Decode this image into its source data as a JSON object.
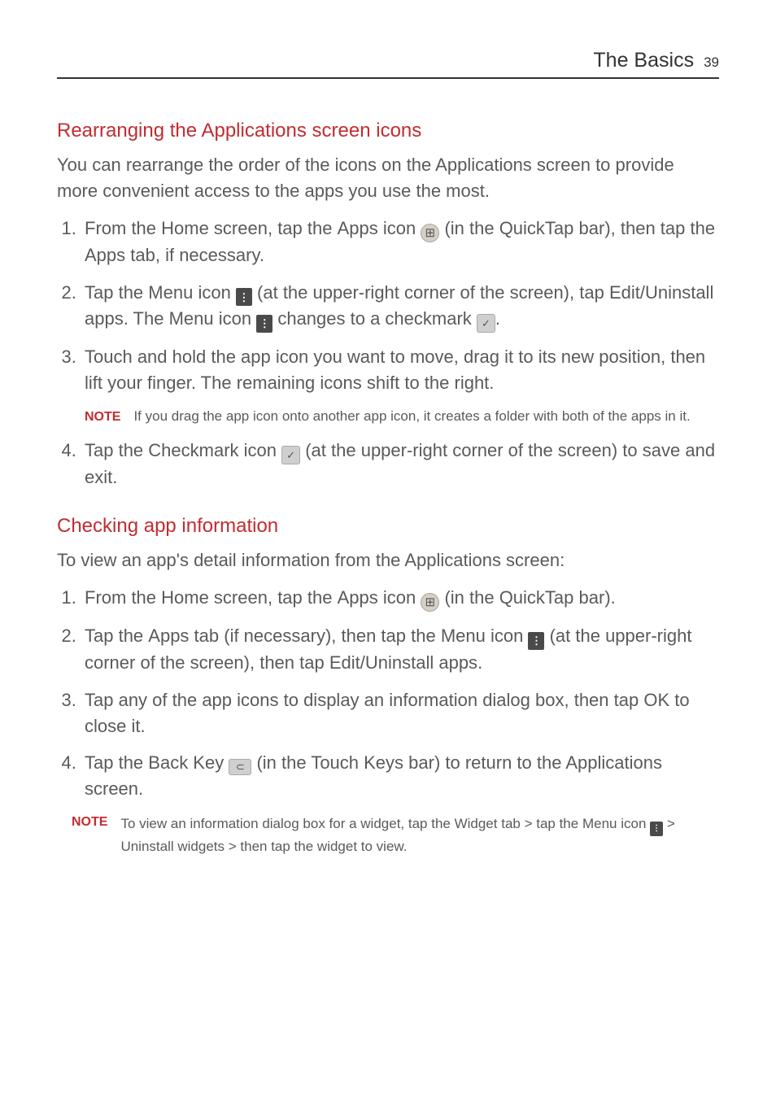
{
  "header": {
    "section": "The Basics",
    "page": "39"
  },
  "sections": [
    {
      "heading": "Rearranging the Applications screen icons",
      "intro": "You can rearrange the order of the icons on the Applications screen to provide more convenient access to the apps you use the most.",
      "steps": {
        "1": {
          "a": "From the Home screen, tap the ",
          "b": "Apps",
          "c": " icon ",
          "d": " (in the QuickTap bar), then tap the ",
          "e": "Apps",
          "f": " tab, if necessary."
        },
        "2": {
          "a": "Tap the ",
          "b": "Menu",
          "c": " icon ",
          "d": " (at the upper-right corner of the screen), tap ",
          "e": "Edit/Uninstall apps",
          "f": ". The ",
          "g": "Menu",
          "h": " icon ",
          "i": " changes to a checkmark ",
          "j": "."
        },
        "3": "Touch and hold the app icon you want to move, drag it to its new position, then lift your finger. The remaining icons shift to the right.",
        "note": {
          "label": "NOTE",
          "text": "If you drag the app icon onto another app icon, it creates a folder with both of the apps in it."
        },
        "4": {
          "a": "Tap the Checkmark icon ",
          "b": " (at the upper-right corner of the screen) to save and exit."
        }
      }
    },
    {
      "heading": "Checking app information",
      "intro": "To view an app's detail information from the Applications screen:",
      "steps": {
        "1": {
          "a": "From the Home screen, tap the ",
          "b": "Apps",
          "c": " icon ",
          "d": " (in the QuickTap bar)."
        },
        "2": {
          "a": "Tap the ",
          "b": "Apps",
          "c": " tab (if necessary), then tap the ",
          "d": "Menu",
          "e": " icon ",
          "f": " (at the upper-right corner of the screen), then tap ",
          "g": "Edit/Uninstall apps",
          "h": "."
        },
        "3": {
          "a": "Tap any of the app icons to display an information dialog box, then tap ",
          "b": "OK",
          "c": " to close it."
        },
        "4": {
          "a": "Tap the ",
          "b": "Back Key",
          "c": " ",
          "d": " (in the Touch Keys bar) to return to the Applications screen."
        }
      },
      "note": {
        "label": "NOTE",
        "a": "To view an information dialog box for a widget, tap the ",
        "b": "Widget",
        "c": " tab > tap the ",
        "d": "Menu",
        "e": " icon ",
        "f": " > ",
        "g": "Uninstall widgets",
        "h": " > then tap the widget to view."
      }
    }
  ]
}
